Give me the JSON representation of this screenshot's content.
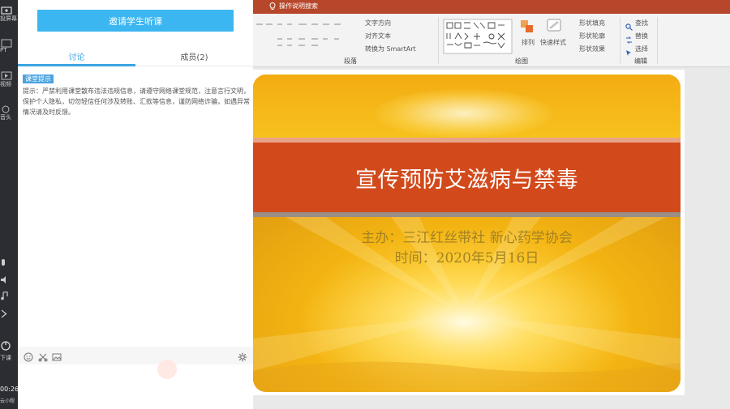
{
  "app_strip": {
    "items": [
      {
        "label": "投屏幕",
        "icon": "cast-icon"
      },
      {
        "label": "PT",
        "icon": "ppt-icon"
      },
      {
        "label": "视频",
        "icon": "video-icon"
      },
      {
        "label": "音头",
        "icon": "camera-icon"
      },
      {
        "label": "",
        "icon": "mic-icon"
      },
      {
        "label": "",
        "icon": "speaker-icon"
      },
      {
        "label": "",
        "icon": "music-icon"
      },
      {
        "label": "",
        "icon": "share-icon"
      },
      {
        "label": "下课",
        "icon": "end-class-icon"
      }
    ],
    "timer": "00:26",
    "timer_sub": "云小程"
  },
  "panel": {
    "invite_button": "邀请学生听课",
    "tabs": [
      {
        "label": "讨论",
        "active": true
      },
      {
        "label": "成员(2)",
        "active": false
      }
    ],
    "notice_badge": "课堂提示",
    "notice_text": "提示：严禁利用课堂散布违法违规信息，请遵守网络课堂规范，注意言行文明，保护个人隐私，切勿轻信任何涉及转账、汇款等信息，谨防网络诈骗，如遇异常情况请及时反馈。",
    "input_icons": [
      "smile-icon",
      "scissors-icon",
      "image-icon"
    ],
    "settings_icon": "gear-icon"
  },
  "ribbon": {
    "search_hint": "操作说明搜索",
    "items": {
      "text_direction": "文字方向",
      "align_text": "对齐文本",
      "smartart": "转换为 SmartArt",
      "arrange": "排列",
      "quick_styles": "快速样式",
      "shape_fill": "形状填充",
      "shape_outline": "形状轮廓",
      "shape_effects": "形状效果",
      "find": "查找",
      "replace": "替换",
      "select": "选择"
    },
    "groups": {
      "paragraph": "段落",
      "drawing": "绘图",
      "editing": "编辑"
    }
  },
  "slide": {
    "title": "宣传预防艾滋病与禁毒",
    "organizer": "主办：三江红丝带社 新心药学协会",
    "date": "时间：2020年5月16日"
  },
  "colors": {
    "accent_blue": "#3cb6f0",
    "ribbon_red": "#b7472a",
    "band_red": "#d24a1c"
  }
}
